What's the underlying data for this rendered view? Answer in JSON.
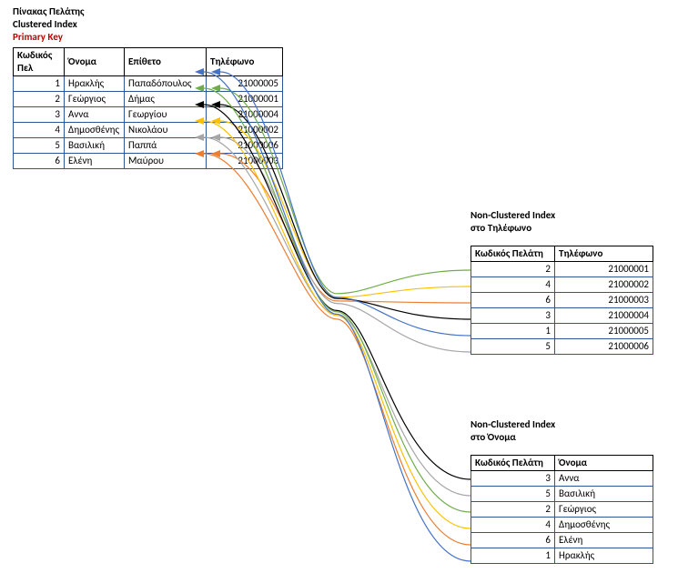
{
  "main_label": {
    "l1": "Πίνακας Πελάτης",
    "l2": "Clustered Index",
    "l3": "Primary Key"
  },
  "main_headers": {
    "h1": "Κωδικός Πελ",
    "h2": "Όνομα",
    "h3": "Επίθετο",
    "h4": "Τηλέφωνο"
  },
  "main_rows": [
    {
      "id": "1",
      "name": "Ηρακλής",
      "surname": "Παπαδόπουλος",
      "phone": "21000005"
    },
    {
      "id": "2",
      "name": "Γεώργιος",
      "surname": "Δήμας",
      "phone": "21000001"
    },
    {
      "id": "3",
      "name": "Αννα",
      "surname": "Γεωργίου",
      "phone": "21000004"
    },
    {
      "id": "4",
      "name": "Δημοσθένης",
      "surname": "Νικολάου",
      "phone": "21000002"
    },
    {
      "id": "5",
      "name": "Βασιλική",
      "surname": "Παππά",
      "phone": "21000006"
    },
    {
      "id": "6",
      "name": "Ελένη",
      "surname": "Μαύρου",
      "phone": "21000003"
    }
  ],
  "idx_phone_label": {
    "l1": "Non-Clustered Index",
    "l2": "στο Τηλέφωνο"
  },
  "idx_phone_headers": {
    "h1": "Κωδικός Πελάτη",
    "h2": "Τηλέφωνο"
  },
  "idx_phone_rows": [
    {
      "id": "2",
      "phone": "21000001"
    },
    {
      "id": "4",
      "phone": "21000002"
    },
    {
      "id": "6",
      "phone": "21000003"
    },
    {
      "id": "3",
      "phone": "21000004"
    },
    {
      "id": "1",
      "phone": "21000005"
    },
    {
      "id": "5",
      "phone": "21000006"
    }
  ],
  "idx_name_label": {
    "l1": "Non-Clustered Index",
    "l2": "στο Όνομα"
  },
  "idx_name_headers": {
    "h1": "Κωδικός Πελάτη",
    "h2": "Όνομα"
  },
  "idx_name_rows": [
    {
      "id": "3",
      "name": "Αννα"
    },
    {
      "id": "5",
      "name": "Βασιλική"
    },
    {
      "id": "2",
      "name": "Γεώργιος"
    },
    {
      "id": "4",
      "name": "Δημοσθένης"
    },
    {
      "id": "6",
      "name": "Ελένη"
    },
    {
      "id": "1",
      "name": "Ηρακλής"
    }
  ],
  "curve_colors": {
    "blue": "#4472c4",
    "green": "#70ad47",
    "orange": "#ed7d31",
    "gold": "#ffc000",
    "black": "#000000",
    "gray": "#a6a6a6"
  }
}
